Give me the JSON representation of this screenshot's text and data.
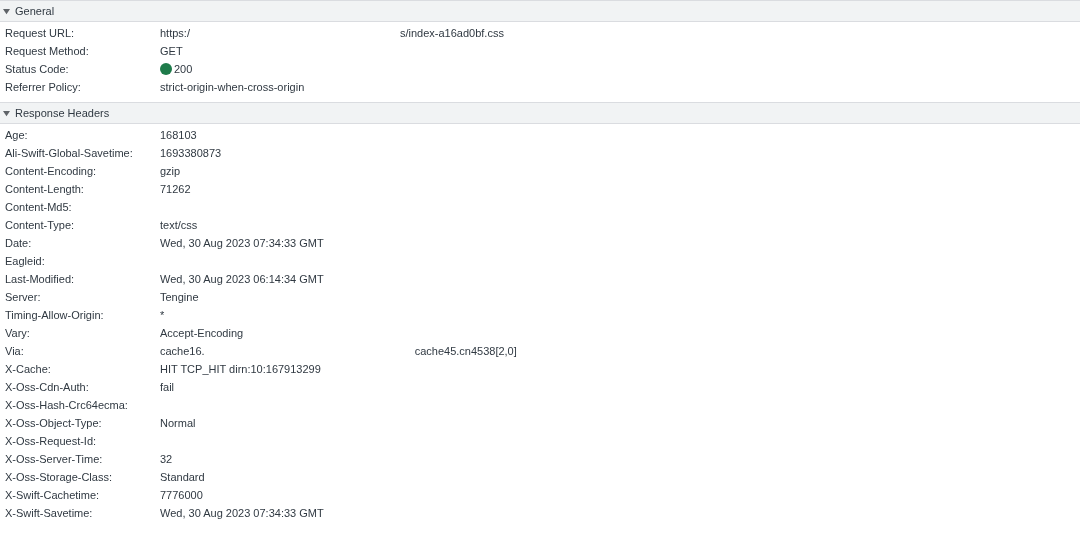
{
  "sections": [
    {
      "title": "General",
      "expanded": true,
      "rows": [
        {
          "name": "Request URL:",
          "value": "https:/",
          "value_tail": "s/index-a16ad0bf.css"
        },
        {
          "name": "Request Method:",
          "value": "GET"
        },
        {
          "name": "Status Code:",
          "kind": "status",
          "color": "#1e7b4a",
          "value": "200"
        },
        {
          "name": "Referrer Policy:",
          "value": "strict-origin-when-cross-origin"
        }
      ]
    },
    {
      "title": "Response Headers",
      "expanded": true,
      "rows": [
        {
          "name": "Age:",
          "value": "168103"
        },
        {
          "name": "Ali-Swift-Global-Savetime:",
          "value": "1693380873"
        },
        {
          "name": "Content-Encoding:",
          "value": "gzip"
        },
        {
          "name": "Content-Length:",
          "value": "71262"
        },
        {
          "name": "Content-Md5:"
        },
        {
          "name": "Content-Type:",
          "value": "text/css"
        },
        {
          "name": "Date:",
          "value": "Wed, 30 Aug 2023 07:34:33 GMT"
        },
        {
          "name": "Eagleid:"
        },
        {
          "name": "Last-Modified:",
          "value": "Wed, 30 Aug 2023 06:14:34 GMT"
        },
        {
          "name": "Server:",
          "value": "Tengine"
        },
        {
          "name": "Timing-Allow-Origin:",
          "value": "*"
        },
        {
          "name": "Vary:",
          "value": "Accept-Encoding"
        },
        {
          "name": "Via:",
          "value": "cache16.",
          "value_tail": "cache45.cn4538[2,0]"
        },
        {
          "name": "X-Cache:",
          "value": "HIT TCP_HIT dirn:10:167913299"
        },
        {
          "name": "X-Oss-Cdn-Auth:",
          "value": "fail"
        },
        {
          "name": "X-Oss-Hash-Crc64ecma:"
        },
        {
          "name": "X-Oss-Object-Type:",
          "value": "Normal"
        },
        {
          "name": "X-Oss-Request-Id:"
        },
        {
          "name": "X-Oss-Server-Time:",
          "value": "32"
        },
        {
          "name": "X-Oss-Storage-Class:",
          "value": "Standard"
        },
        {
          "name": "X-Swift-Cachetime:",
          "value": "7776000"
        },
        {
          "name": "X-Swift-Savetime:",
          "value": "Wed, 30 Aug 2023 07:34:33 GMT"
        }
      ]
    }
  ]
}
